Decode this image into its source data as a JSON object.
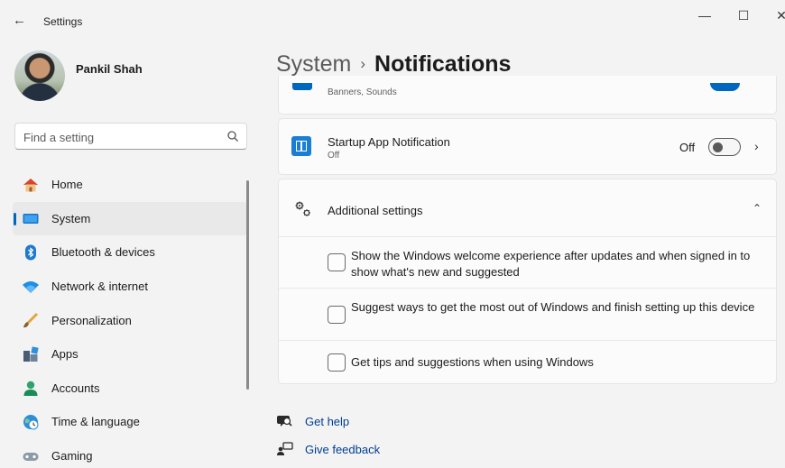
{
  "window": {
    "title": "Settings",
    "back_glyph": "←",
    "minimize_glyph": "—",
    "maximize_glyph": "☐",
    "close_glyph": "✕"
  },
  "user": {
    "name": "Pankil Shah"
  },
  "search": {
    "placeholder": "Find a setting",
    "value": "",
    "icon": "search-icon"
  },
  "sidebar": {
    "items": [
      {
        "label": "Home",
        "icon": "home-icon",
        "active": false
      },
      {
        "label": "System",
        "icon": "system-icon",
        "active": true
      },
      {
        "label": "Bluetooth & devices",
        "icon": "bluetooth-icon",
        "active": false
      },
      {
        "label": "Network & internet",
        "icon": "wifi-icon",
        "active": false
      },
      {
        "label": "Personalization",
        "icon": "brush-icon",
        "active": false
      },
      {
        "label": "Apps",
        "icon": "apps-icon",
        "active": false
      },
      {
        "label": "Accounts",
        "icon": "accounts-icon",
        "active": false
      },
      {
        "label": "Time & language",
        "icon": "globe-clock-icon",
        "active": false
      },
      {
        "label": "Gaming",
        "icon": "gamepad-icon",
        "active": false
      }
    ]
  },
  "breadcrumb": {
    "parent": "System",
    "separator": "›",
    "current": "Notifications"
  },
  "partial_row": {
    "subtitle": "Banners, Sounds"
  },
  "startup_app": {
    "title": "Startup App Notification",
    "subtitle": "Off",
    "toggle_label": "Off",
    "toggle_on": false,
    "chevron": "›"
  },
  "additional": {
    "title": "Additional settings",
    "chevron": "⌃",
    "options": [
      {
        "label": "Show the Windows welcome experience after updates and when signed in to show what's new and suggested",
        "checked": false
      },
      {
        "label": "Suggest ways to get the most out of Windows and finish setting up this device",
        "checked": false
      },
      {
        "label": "Get tips and suggestions when using Windows",
        "checked": false
      }
    ]
  },
  "footer": {
    "help": "Get help",
    "feedback": "Give feedback"
  },
  "colors": {
    "accent": "#0067c0",
    "link": "#003e92",
    "background": "#f3f3f3",
    "card": "#fbfbfb"
  }
}
